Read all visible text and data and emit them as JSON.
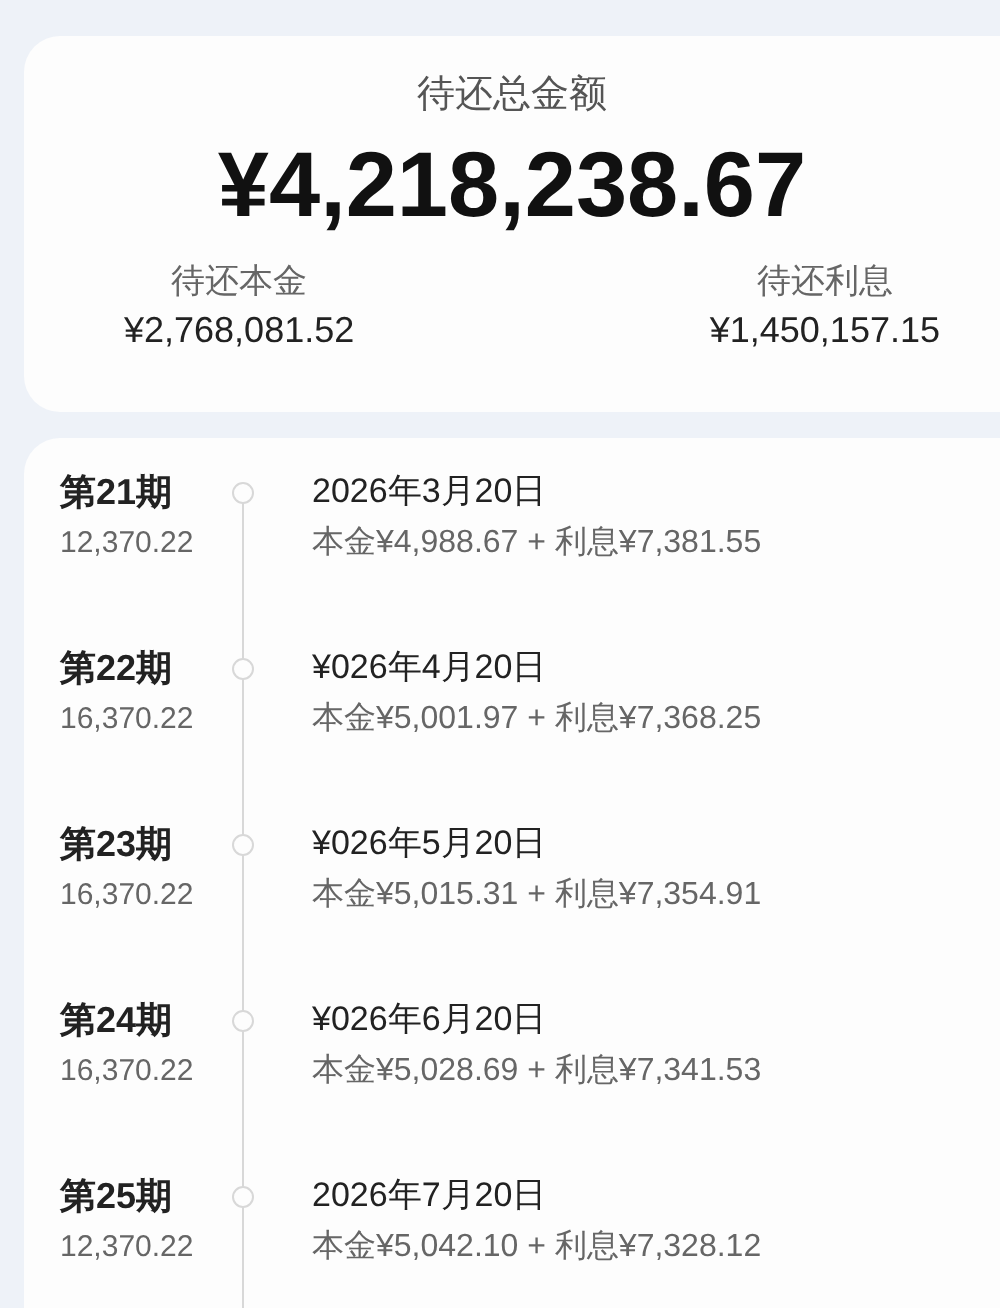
{
  "summary": {
    "total_label": "待还总金额",
    "total": "¥4,218,238.67",
    "principal_label": "待还本金",
    "principal": "¥2,768,081.52",
    "interest_label": "待还利息",
    "interest": "¥1,450,157.15"
  },
  "installments": [
    {
      "period": "第21期",
      "amount": "12,370.22",
      "date": "2026年3月20日",
      "detail": "本金¥4,988.67 + 利息¥7,381.55"
    },
    {
      "period": "第22期",
      "amount": "16,370.22",
      "date": "¥026年4月20日",
      "detail": "本金¥5,001.97 + 利息¥7,368.25"
    },
    {
      "period": "第23期",
      "amount": "16,370.22",
      "date": "¥026年5月20日",
      "detail": "本金¥5,015.31 + 利息¥7,354.91"
    },
    {
      "period": "第24期",
      "amount": "16,370.22",
      "date": "¥026年6月20日",
      "detail": "本金¥5,028.69 + 利息¥7,341.53"
    },
    {
      "period": "第25期",
      "amount": "12,370.22",
      "date": "2026年7月20日",
      "detail": "本金¥5,042.10 + 利息¥7,328.12"
    }
  ]
}
